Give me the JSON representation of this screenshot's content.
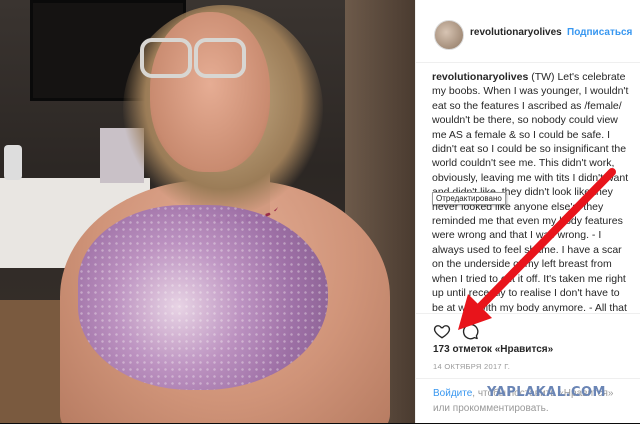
{
  "post": {
    "username": "revolutionaryolives",
    "follow_label": "Подписаться",
    "caption_user": "revolutionaryolives",
    "caption_text": " (TW) Let's celebrate my boobs. When I was younger, I wouldn't eat so the features I ascribed as /female/ wouldn't be there, so nobody could view me AS a female & so I could be safe. I didn't eat so I could be so insignificant the world couldn't see me. This didn't work, obviously, leaving me with tits I didn't want and didn't like, they didn't look like they never looked like anyone else's, they reminded me that even my body features were wrong and that I was wrong. - I always used to feel shame. I have a scar on the underside of my left breast from when I tried to cut it off. It's taken me right up until recently to realise I don't have to be at war with my body anymore. - All that really matters is I have a space on",
    "tooltip": "Отредактировано",
    "likes": "173 отметок «Нравится»",
    "date": "14 ОКТЯБРЯ 2017 Г.",
    "login_link": "Войдите",
    "login_text": ", чтобы поставить «Нравится» или прокомментировать."
  },
  "icons": {
    "like": "heart-icon",
    "comment": "comment-icon"
  },
  "watermark": "YAPLAKAL.COM",
  "colors": {
    "accent": "#3897f0",
    "arrow": "#e8141b"
  }
}
